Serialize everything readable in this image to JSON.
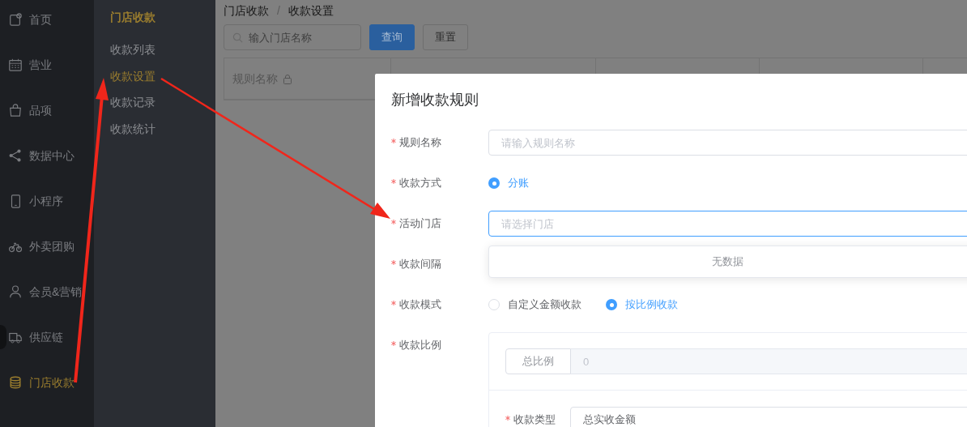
{
  "sidebar": {
    "items": [
      {
        "label": "首页",
        "selected": false
      },
      {
        "label": "营业",
        "selected": false
      },
      {
        "label": "品项",
        "selected": false
      },
      {
        "label": "数据中心",
        "selected": false
      },
      {
        "label": "小程序",
        "selected": false
      },
      {
        "label": "外卖团购",
        "selected": false
      },
      {
        "label": "会员&营销",
        "selected": false
      },
      {
        "label": "供应链",
        "selected": false
      },
      {
        "label": "门店收款",
        "selected": true
      }
    ]
  },
  "submenu": {
    "title": "门店收款",
    "items": [
      {
        "label": "收款列表",
        "selected": false
      },
      {
        "label": "收款设置",
        "selected": true
      },
      {
        "label": "收款记录",
        "selected": false
      },
      {
        "label": "收款统计",
        "selected": false
      }
    ]
  },
  "breadcrumb": {
    "items": [
      "门店收款",
      "收款设置"
    ],
    "separator": "/"
  },
  "toolbar": {
    "search": {
      "placeholder": "输入门店名称"
    },
    "buttons": [
      {
        "label": "查询",
        "kind": "primary"
      },
      {
        "label": "重置",
        "kind": "default"
      }
    ]
  },
  "table": {
    "columns": [
      "规则名称"
    ]
  },
  "dialog": {
    "title": "新增收款规则",
    "fields": [
      {
        "kind": "input",
        "label": "规则名称",
        "required": true,
        "placeholder": "请输入规则名称"
      },
      {
        "kind": "radio",
        "label": "收款方式",
        "required": true,
        "options": [
          {
            "label": "分账",
            "selected": true
          }
        ]
      },
      {
        "kind": "select",
        "label": "活动门店",
        "required": true,
        "placeholder": "请选择门店",
        "focused": true,
        "dropdown": {
          "empty_text": "无数据"
        }
      },
      {
        "kind": "blank",
        "label": "收款间隔",
        "required": true
      },
      {
        "kind": "radio",
        "label": "收款模式",
        "required": true,
        "options": [
          {
            "label": "自定义金额收款",
            "selected": false
          },
          {
            "label": "按比例收款",
            "selected": true
          }
        ]
      },
      {
        "kind": "ratio",
        "label": "收款比例",
        "required": true,
        "addon": "总比例",
        "value": "0",
        "sub_field": {
          "label": "收款类型",
          "required": true,
          "value": "总实收金额"
        }
      }
    ]
  }
}
